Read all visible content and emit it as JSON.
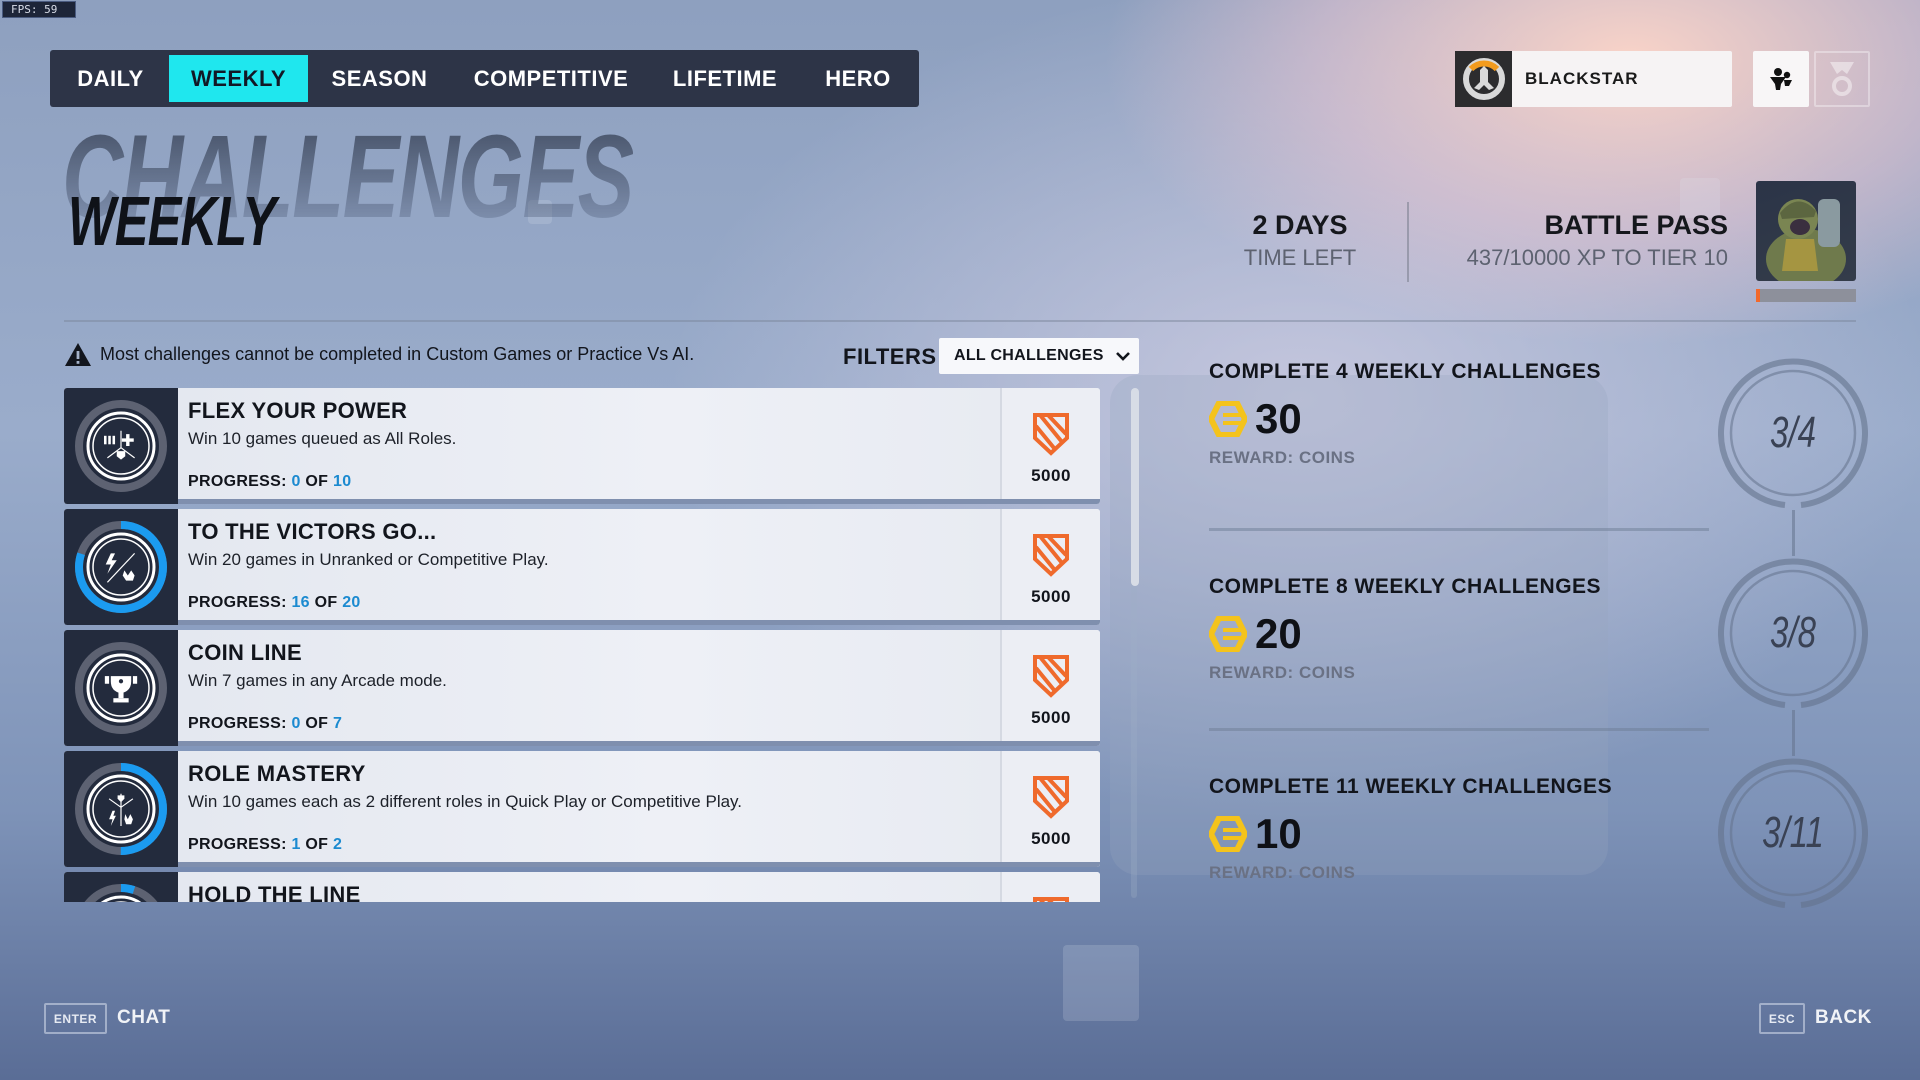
{
  "fps": "FPS:  59",
  "tabs": [
    {
      "label": "DAILY",
      "active": false
    },
    {
      "label": "WEEKLY",
      "active": true
    },
    {
      "label": "SEASON",
      "active": false
    },
    {
      "label": "COMPETITIVE",
      "active": false
    },
    {
      "label": "LIFETIME",
      "active": false
    },
    {
      "label": "HERO",
      "active": false
    }
  ],
  "profile": {
    "name": "BLACKSTAR",
    "logo_icon": "overwatch-logo-icon"
  },
  "header": {
    "bg_title": "CHALLENGES",
    "title": "WEEKLY",
    "time_left_value": "2 DAYS",
    "time_left_label": "TIME LEFT",
    "battle_pass_title": "BATTLE PASS",
    "battle_pass_progress": "437/10000 XP TO TIER 10",
    "battle_pass_fraction": 0.0437
  },
  "warning": "Most challenges cannot be completed in Custom Games or Practice Vs AI.",
  "filters": {
    "label": "FILTERS",
    "selected": "ALL CHALLENGES"
  },
  "challenges": [
    {
      "title": "FLEX YOUR POWER",
      "description": "Win 10 games queued as All Roles.",
      "progress_label": "PROGRESS:",
      "current": "0",
      "of": "OF",
      "total": "10",
      "reward": "5000",
      "fraction": 0,
      "icon": "all-roles-icon"
    },
    {
      "title": "TO THE VICTORS GO...",
      "description": "Win 20 games in Unranked or Competitive Play.",
      "progress_label": "PROGRESS:",
      "current": "16",
      "of": "OF",
      "total": "20",
      "reward": "5000",
      "fraction": 0.8,
      "icon": "unranked-competitive-icon"
    },
    {
      "title": "COIN LINE",
      "description": "Win 7 games in any Arcade mode.",
      "progress_label": "PROGRESS:",
      "current": "0",
      "of": "OF",
      "total": "7",
      "reward": "5000",
      "fraction": 0,
      "icon": "arcade-trophy-icon"
    },
    {
      "title": "ROLE MASTERY",
      "description": "Win 10 games each as 2 different roles in Quick Play or Competitive Play.",
      "progress_label": "PROGRESS:",
      "current": "1",
      "of": "OF",
      "total": "2",
      "reward": "5000",
      "fraction": 0.5,
      "icon": "role-mastery-icon"
    },
    {
      "title": "HOLD THE LINE",
      "description": "",
      "progress_label": "",
      "current": "",
      "of": "",
      "total": "",
      "reward": "",
      "fraction": 0.05,
      "icon": "hold-line-icon"
    }
  ],
  "milestones": [
    {
      "title": "COMPLETE 4 WEEKLY CHALLENGES",
      "amount": "30",
      "reward_label": "REWARD:  COINS",
      "progress": "3/4",
      "fraction": 0.75
    },
    {
      "title": "COMPLETE 8 WEEKLY CHALLENGES",
      "amount": "20",
      "reward_label": "REWARD:  COINS",
      "progress": "3/8",
      "fraction": 0.375
    },
    {
      "title": "COMPLETE 11 WEEKLY CHALLENGES",
      "amount": "10",
      "reward_label": "REWARD:  COINS",
      "progress": "3/11",
      "fraction": 0.2727
    }
  ],
  "footer": {
    "chat_key": "ENTER",
    "chat_label": "CHAT",
    "back_key": "ESC",
    "back_label": "BACK"
  },
  "colors": {
    "accent": "#1fe7ee",
    "progress_blue": "#1b8ad0",
    "xp_orange": "#f2692b",
    "coin_yellow": "#f4c31c"
  }
}
